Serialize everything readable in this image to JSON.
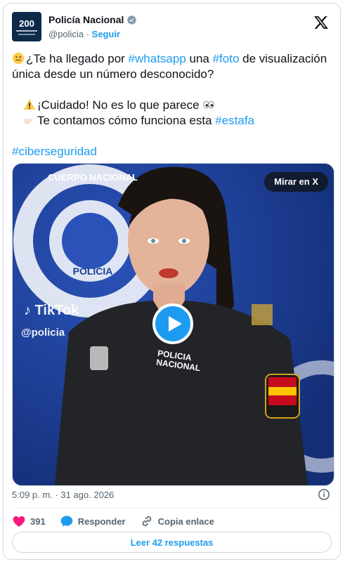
{
  "account": {
    "avatar_text": "200",
    "name": "Policía Nacional",
    "handle": "@policia",
    "separator": "·",
    "follow_label": "Seguir"
  },
  "post": {
    "line1_pre": "¿Te ha llegado por ",
    "tag_whatsapp": "#whatsapp",
    "line1_mid": " una ",
    "tag_foto": "#foto",
    "line1_post": " de visualización única desde un número desconocido?",
    "line2": "¡Cuidado! No es lo que parece",
    "line3_pre": "Te contamos cómo funciona esta ",
    "tag_estafa": "#estafa",
    "tag_ciberseguridad": "#ciberseguridad"
  },
  "media": {
    "watch_label": "Mirar en X",
    "tiktok_label": "TikTok",
    "tiktok_handle": "@policia",
    "seal_text_top": "CUERPO NACIONAL",
    "seal_text_bottom": "POLICIA",
    "badge_text_1": "POLICIA",
    "badge_text_2": "NACIONAL"
  },
  "meta": {
    "timestamp": "5:09 p. m. · 31 ago. 2026"
  },
  "actions": {
    "like_count": "391",
    "reply_label": "Responder",
    "copy_label": "Copia enlace",
    "read_label": "Leer 42 respuestas"
  },
  "colors": {
    "accent": "#1d9bf0",
    "like": "#f91880",
    "media_bg": "#1b3f9a"
  }
}
